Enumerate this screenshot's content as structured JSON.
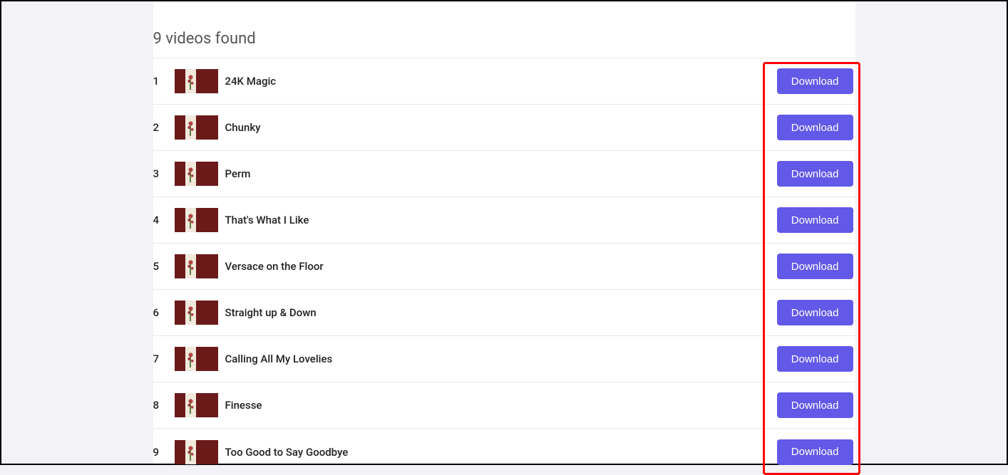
{
  "heading": "9 videos found",
  "download_label": "Download",
  "videos": [
    {
      "index": "1",
      "title": "24K Magic"
    },
    {
      "index": "2",
      "title": "Chunky"
    },
    {
      "index": "3",
      "title": "Perm"
    },
    {
      "index": "4",
      "title": "That's What I Like"
    },
    {
      "index": "5",
      "title": "Versace on the Floor"
    },
    {
      "index": "6",
      "title": "Straight up & Down"
    },
    {
      "index": "7",
      "title": "Calling All My Lovelies"
    },
    {
      "index": "8",
      "title": "Finesse"
    },
    {
      "index": "9",
      "title": "Too Good to Say Goodbye"
    }
  ]
}
